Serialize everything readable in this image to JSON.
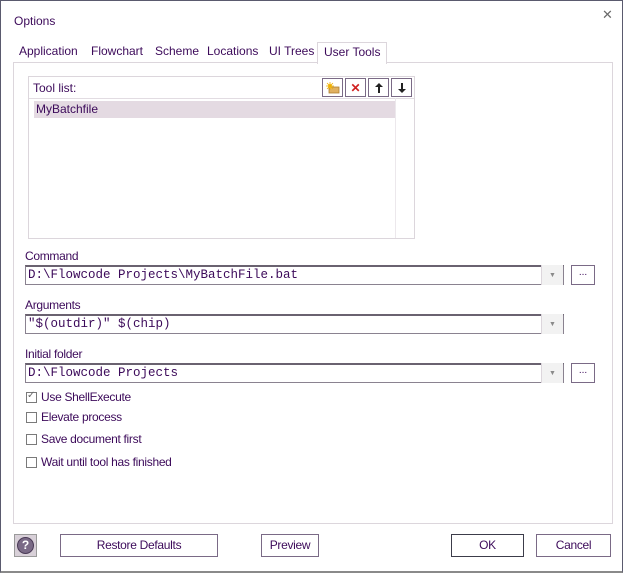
{
  "window": {
    "title": "Options",
    "close_icon": "close-icon"
  },
  "tabs": [
    {
      "label": "Application",
      "active": false
    },
    {
      "label": "Flowchart",
      "active": false
    },
    {
      "label": "Scheme",
      "active": false
    },
    {
      "label": "Locations",
      "active": false
    },
    {
      "label": "UI Trees",
      "active": false
    },
    {
      "label": "User Tools",
      "active": true
    }
  ],
  "tool_list": {
    "label": "Tool list:",
    "buttons": [
      {
        "name": "new-tool",
        "icon": "new-folder-icon"
      },
      {
        "name": "delete-tool",
        "icon": "delete-icon",
        "glyph": "✕"
      },
      {
        "name": "move-up",
        "icon": "arrow-up-icon",
        "glyph": "🡑"
      },
      {
        "name": "move-down",
        "icon": "arrow-down-icon",
        "glyph": "🡓"
      }
    ],
    "items": [
      {
        "label": "MyBatchfile",
        "selected": true
      }
    ]
  },
  "fields": {
    "command": {
      "label": "Command",
      "value": "D:\\Flowcode Projects\\MyBatchFile.bat",
      "browse_label": "..."
    },
    "arguments": {
      "label": "Arguments",
      "value": "\"$(outdir)\" $(chip)"
    },
    "initial_folder": {
      "label": "Initial folder",
      "value": "D:\\Flowcode Projects",
      "browse_label": "..."
    }
  },
  "checkboxes": [
    {
      "label": "Use ShellExecute",
      "checked": true
    },
    {
      "label": "Elevate process",
      "checked": false
    },
    {
      "label": "Save document first",
      "checked": false
    },
    {
      "label": "Wait until tool has finished",
      "checked": false
    }
  ],
  "footer": {
    "help_glyph": "?",
    "restore_defaults": "Restore Defaults",
    "preview": "Preview",
    "ok": "OK",
    "cancel": "Cancel"
  },
  "colors": {
    "accent": "#3c0a5a",
    "selection": "#e4dae2",
    "border": "#7a6a86"
  }
}
